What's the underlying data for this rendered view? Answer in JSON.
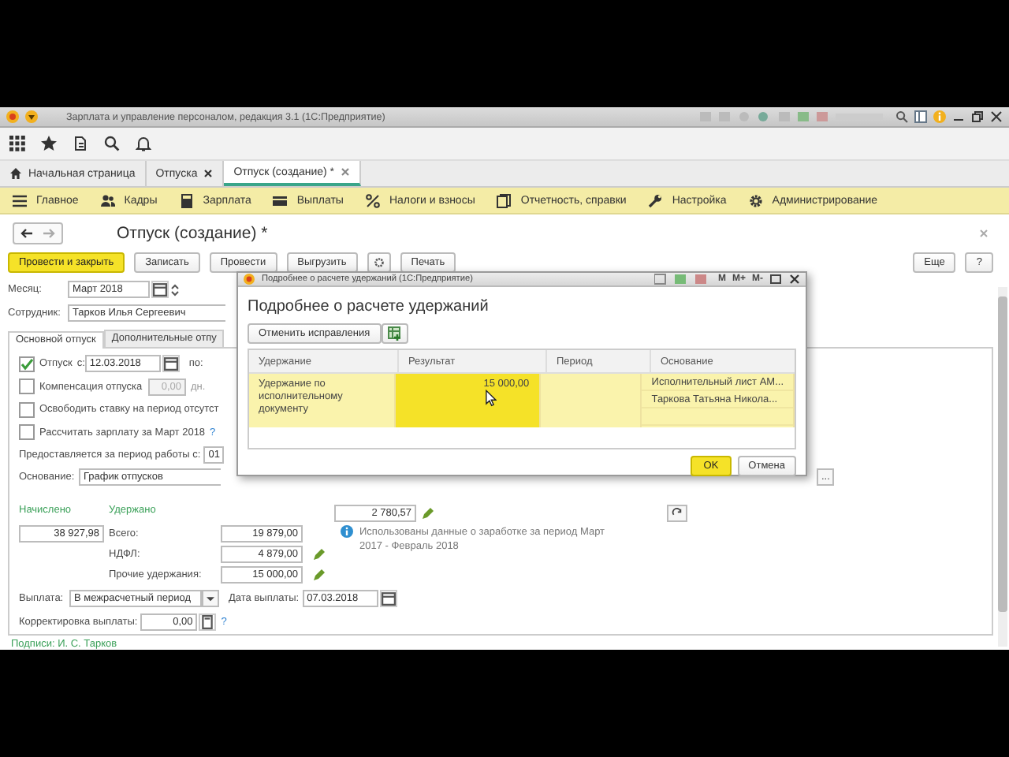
{
  "window": {
    "title": "Зарплата и управление персоналом, редакция 3.1  (1С:Предприятие)"
  },
  "tabs": [
    {
      "label": "Начальная страница",
      "selected": false
    },
    {
      "label": "Отпуска",
      "selected": false
    },
    {
      "label": "Отпуск (создание) *",
      "selected": true
    }
  ],
  "sections": [
    "Главное",
    "Кадры",
    "Зарплата",
    "Выплаты",
    "Налоги и взносы",
    "Отчетность, справки",
    "Настройка",
    "Администрирование"
  ],
  "form": {
    "title": "Отпуск (создание) *",
    "post_close": "Провести и закрыть",
    "save": "Записать",
    "post": "Провести",
    "upload": "Выгрузить",
    "print": "Печать",
    "more": "Еще",
    "help": "?",
    "month_label": "Месяц:",
    "month": "Март 2018",
    "employee_label": "Сотрудник:",
    "employee": "Тарков Илья Сергеевич",
    "page_tabs": [
      {
        "label": "Основной отпуск",
        "selected": true
      },
      {
        "label": "Дополнительные отпу",
        "selected": false
      }
    ],
    "vacation": {
      "checked": true,
      "label": "Отпуск",
      "from_label": "с:",
      "from": "12.03.2018",
      "to_label": "по:"
    },
    "compensation": {
      "checked": false,
      "label": "Компенсация отпуска",
      "days": "0,00",
      "disabled": true,
      "unit": "дн."
    },
    "release_rate": {
      "checked": false,
      "label": "Освободить ставку на период отсутст"
    },
    "calculate": {
      "checked": false,
      "label": "Рассчитать зарплату за Март 2018",
      "help": "?"
    },
    "work_period_label": "Предоставляется за период работы с:",
    "work_period": "01",
    "basis_label": "Основание:",
    "basis": "График отпусков",
    "basis_choose": "...",
    "accrued_label": "Начислено",
    "accrued": "38 927,98",
    "withheld_label": "Удержано",
    "total_label": "Всего:",
    "total": "19 879,00",
    "ndfl_label": "НДФЛ:",
    "ndfl": "4 879,00",
    "other_label": "Прочие удержания:",
    "other": "15 000,00",
    "average": "2 780,57",
    "info": "Использованы данные о заработке за период Март 2017 - Февраль 2018",
    "payout_label": "Выплата:",
    "payout": "В межрасчетный период",
    "payout_date_label": "Дата выплаты:",
    "payout_date": "07.03.2018",
    "correction_label": "Корректировка выплаты:",
    "correction": "0,00",
    "correction_help": "?",
    "signatures": "Подписи: И. С. Тарков"
  },
  "dialog": {
    "title": "Подробнее о расчете удержаний  (1С:Предприятие)",
    "title_buttons": [
      "M",
      "M+",
      "M-"
    ],
    "heading": "Подробнее о расчете удержаний",
    "undo": "Отменить исправления",
    "columns": [
      "Удержание",
      "Результат",
      "Период",
      "Основание"
    ],
    "rows": [
      {
        "selected": true,
        "deduction": "Удержание по исполнительному документу",
        "result": "15 000,00",
        "result_focused": true,
        "basis": [
          "Исполнительный лист АМ...",
          "Таркова Татьяна Никола..."
        ]
      }
    ],
    "ok": "OK",
    "cancel": "Отмена"
  }
}
